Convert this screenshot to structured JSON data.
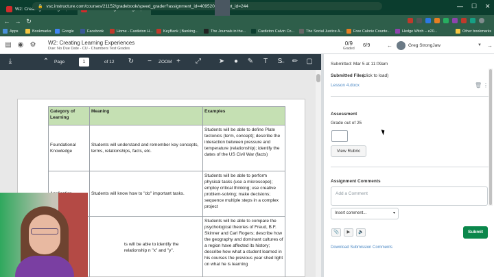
{
  "browser": {
    "tabs": [
      {
        "title": "W2: Creating Learning Experiences",
        "active": false
      },
      {
        "title": "W2: Creating Learning Experiences",
        "active": true
      }
    ],
    "url": "vsc.instructure.com/courses/21152/gradebook/speed_grader?assignment_id=409520&student_id=244",
    "bookmarks": [
      "Apps",
      "Bookmarks",
      "Google",
      "Facebook",
      "Home - Castleton H...",
      "KeyBank | Banking...",
      "The Journals in the...",
      "Castleton Calvin Co...",
      "The Social Justice A...",
      "Free Calorie Counte...",
      "Hedge Witch – e20...",
      "Other bookmarks"
    ]
  },
  "speedgrader": {
    "title": "W2: Creating Learning Experiences",
    "subtitle": "Due: No Due Date - CU - Chambers Test Grades",
    "graded_count": "0/9",
    "graded_label": "Graded",
    "pager": "6/9",
    "student_name": "Greg StrongJaw"
  },
  "docviewer": {
    "page_label": "Page",
    "page_value": "1",
    "page_total": "of 12",
    "zoom_label": "ZOOM"
  },
  "document_table": {
    "headers": [
      "Category of Learning",
      "Meaning",
      "Examples"
    ],
    "rows": [
      {
        "category": "Foundational Knowledge",
        "meaning": "Students will understand and remember key concepts, terms, relationships, facts, etc.",
        "examples": "Students will be able to define Plate tectonics (term, concept); describe the interaction between pressure and temperature (relationship); identify the dates of the US Civil War (facts)"
      },
      {
        "category": "Application",
        "meaning": "Students will know how to \"do\" important tasks.",
        "examples": "Students will be able to perform physical tasks (use a microscope); employ critical thinking; use creative problem-solving; make decisions; sequence multiple steps in a complex project"
      },
      {
        "category": "",
        "meaning": "ts will be able to identify the relationship n \"x\" and \"y\".",
        "examples": "Students will be able to compare the psychological theories of Freud, B.F. Skinner and Carl Rogers; describe how the geography and dominant cultures of a region have affected its history; describe how what a student learned in his courses the previous year shed light on what he is learning"
      }
    ]
  },
  "panel": {
    "submitted": "Submitted: Mar 5 at 11:09am",
    "submitted_files_label": "Submitted Files:",
    "submitted_files_hint": "(click to load)",
    "file_name": "Lesson 4.docx",
    "assessment_label": "Assessment",
    "grade_out_of": "Grade out of 25",
    "view_rubric": "View Rubric",
    "comments_label": "Assignment Comments",
    "comment_placeholder": "Add a Comment",
    "insert_comment": "Insert comment...",
    "submit": "Submit",
    "download_comments": "Download Submission Comments"
  },
  "colors": {
    "browser_frame": "#2e5e4a",
    "canvas_toolbar": "#2d3b45",
    "table_header": "#c5e0b3",
    "submit_button": "#0b874b",
    "link": "#4b88c4"
  }
}
